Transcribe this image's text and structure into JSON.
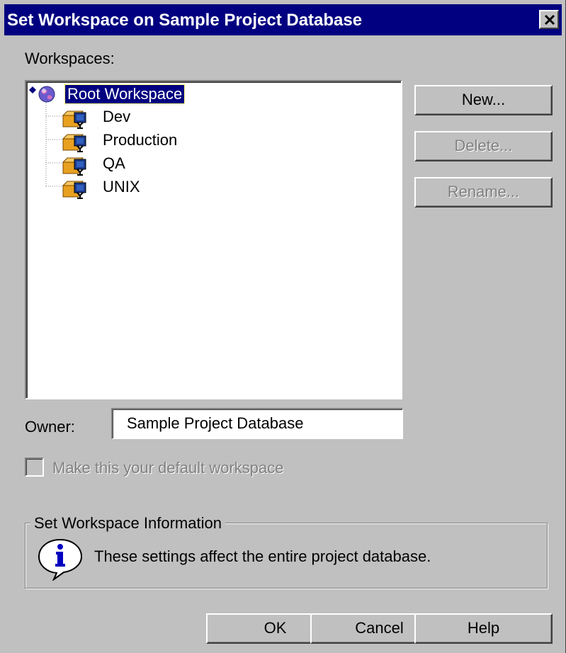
{
  "window": {
    "title": "Set Workspace on Sample Project Database"
  },
  "workspaces_label": "Workspaces:",
  "tree": {
    "root": "Root Workspace",
    "children": [
      "Dev",
      "Production",
      "QA",
      "UNIX"
    ]
  },
  "buttons": {
    "new": "New...",
    "delete": "Delete...",
    "rename": "Rename..."
  },
  "owner": {
    "label": "Owner:",
    "value": "Sample Project Database"
  },
  "default_checkbox": {
    "label": "Make this your default workspace",
    "checked": false,
    "enabled": false
  },
  "info_group": {
    "title": "Set Workspace Information",
    "text": "These settings affect the entire project database.",
    "icon": "info-icon"
  },
  "footer": {
    "ok": "OK",
    "cancel": "Cancel",
    "help": "Help"
  },
  "colors": {
    "titlebar": "#000080",
    "face": "#c0c0c0",
    "selection": "#000080"
  }
}
